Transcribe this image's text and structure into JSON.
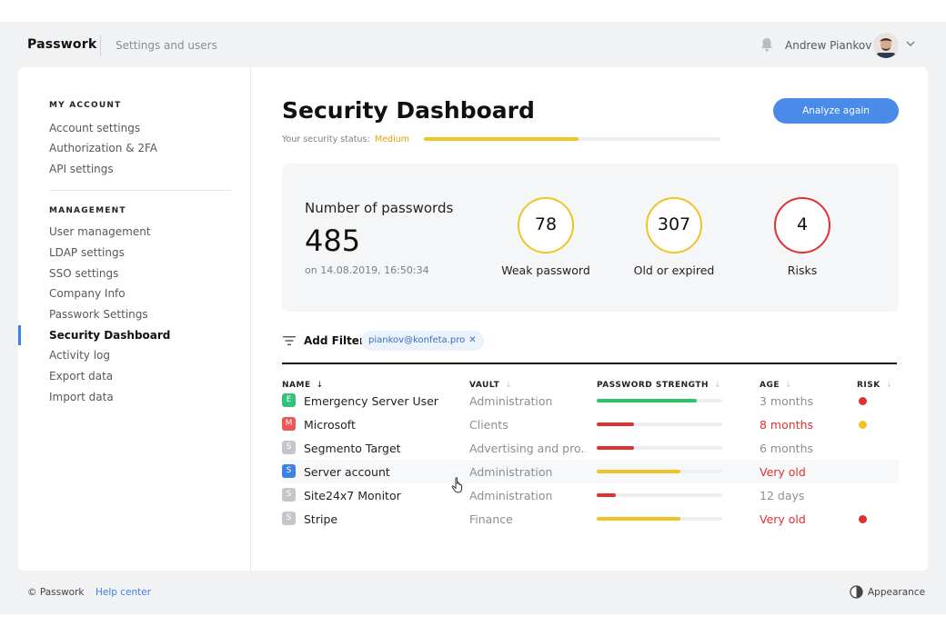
{
  "header": {
    "app_name": "Passwork",
    "section": "Settings and users",
    "user_name": "Andrew Piankov"
  },
  "sidebar": {
    "my_account_heading": "MY ACCOUNT",
    "my_account_items": [
      {
        "label": "Account settings"
      },
      {
        "label": "Authorization & 2FA"
      },
      {
        "label": "API settings"
      }
    ],
    "management_heading": "MANAGEMENT",
    "management_items": [
      {
        "label": "User management"
      },
      {
        "label": "LDAP settings"
      },
      {
        "label": "SSO settings"
      },
      {
        "label": "Company Info"
      },
      {
        "label": "Passwork Settings"
      },
      {
        "label": "Security Dashboard",
        "active": true
      },
      {
        "label": "Activity log"
      },
      {
        "label": "Export data"
      },
      {
        "label": "Import data"
      }
    ]
  },
  "main": {
    "title": "Security Dashboard",
    "status_label": "Your security status:",
    "status_value": "Medium",
    "status_progress": 0.52,
    "analyze_button": "Analyze again",
    "stats": {
      "passwords_label": "Number of passwords",
      "passwords_count": "485",
      "passwords_date": "on 14.08.2019, 16:50:34",
      "weak_value": "78",
      "weak_label": "Weak password",
      "old_value": "307",
      "old_label": "Old or expired",
      "risks_value": "4",
      "risks_label": "Risks"
    },
    "filter": {
      "add_label": "Add Filter",
      "chip": "piankov@konfeta.pro",
      "chip_remove": "✕"
    },
    "table": {
      "headers": {
        "name": "NAME",
        "vault": "VAULT",
        "strength": "PASSWORD STRENGTH",
        "age": "AGE",
        "risk": "RISK"
      },
      "sort_arrows": {
        "name": "↓",
        "other": "↓"
      },
      "rows": [
        {
          "letter": "E",
          "name": "Emergency Server User",
          "vault": "Administration",
          "strength": 0.8,
          "strength_color": "#2cc46b",
          "age": "3 months",
          "age_color": "#8a8d93",
          "risk_color": "#e0312f",
          "badge_color": "#34c17a",
          "highlight": false
        },
        {
          "letter": "M",
          "name": "Microsoft",
          "vault": "Clients",
          "strength": 0.3,
          "strength_color": "#e0312f",
          "age": "8 months",
          "age_color": "#e0312f",
          "risk_color": "#f2c324",
          "badge_color": "#ec5757",
          "highlight": false
        },
        {
          "letter": "S",
          "name": "Segmento Target",
          "vault": "Advertising and pro...",
          "strength": 0.3,
          "strength_color": "#e0312f",
          "age": "6 months",
          "age_color": "#8a8d93",
          "risk_color": "",
          "badge_color": "#c4c6cb",
          "highlight": false
        },
        {
          "letter": "S",
          "name": "Server account",
          "vault": "Administration",
          "strength": 0.67,
          "strength_color": "#f2c324",
          "age": "Very old",
          "age_color": "#e0312f",
          "risk_color": "",
          "badge_color": "#3f80e5",
          "highlight": true
        },
        {
          "letter": "S",
          "name": "Site24x7 Monitor",
          "vault": "Administration",
          "strength": 0.15,
          "strength_color": "#e0312f",
          "age": "12 days",
          "age_color": "#8a8d93",
          "risk_color": "",
          "badge_color": "#c4c6cb",
          "highlight": false
        },
        {
          "letter": "S",
          "name": "Stripe",
          "vault": "Finance",
          "strength": 0.67,
          "strength_color": "#f2c324",
          "age": "Very old",
          "age_color": "#e0312f",
          "risk_color": "#e0312f",
          "badge_color": "#c4c6cb",
          "highlight": false
        }
      ]
    }
  },
  "footer": {
    "copyright": "© Passwork",
    "help": "Help center",
    "appearance": "Appearance"
  },
  "colors": {
    "accent": "#4a8ae9",
    "warning": "#f2c324",
    "danger": "#e0312f",
    "success": "#2cc46b"
  },
  "icons": {
    "bell": "bell-icon",
    "chevron": "chevron-down-icon",
    "filter": "filter-icon",
    "appearance": "contrast-icon",
    "cursor": "hand-pointer-icon"
  }
}
